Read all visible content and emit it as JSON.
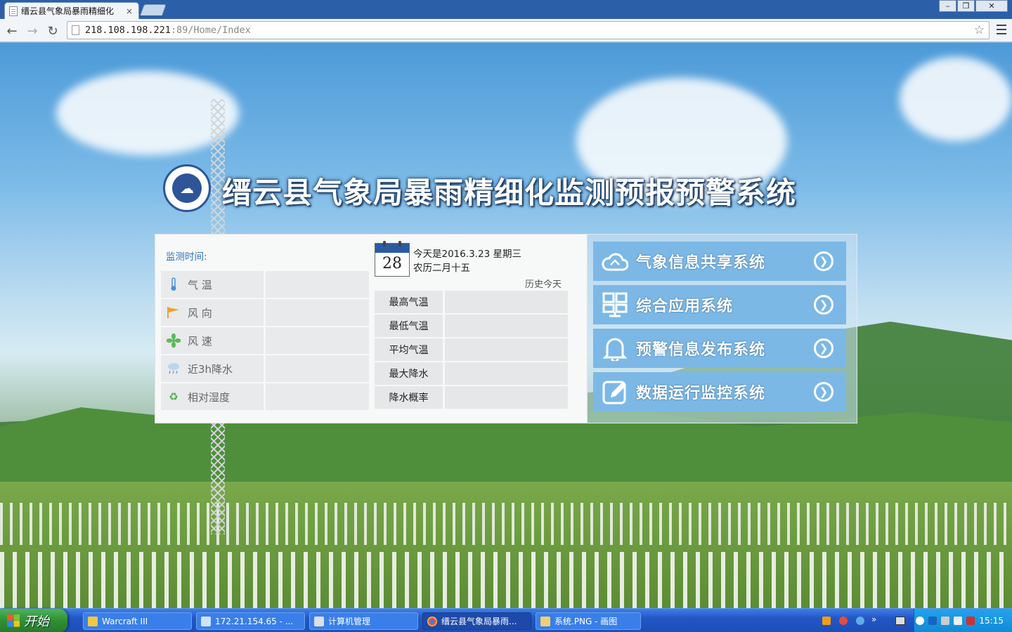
{
  "browser": {
    "tab_title": "缙云县气象局暴雨精细化",
    "tab_close": "×",
    "url_host": "218.108.198.221",
    "url_path": ":89/Home/Index",
    "win_min": "–",
    "win_restore": "❐",
    "win_close": "✕"
  },
  "header": {
    "title": "缙云县气象局暴雨精细化监测预报预警系统"
  },
  "monitor": {
    "time_label": "监测时间:",
    "rows": [
      {
        "label": "气 温",
        "icon": "thermometer-icon",
        "value": ""
      },
      {
        "label": "风 向",
        "icon": "wind-direction-icon",
        "value": ""
      },
      {
        "label": "风 速",
        "icon": "fan-icon",
        "value": ""
      },
      {
        "label": "近3h降水",
        "icon": "rain-cloud-icon",
        "value": ""
      },
      {
        "label": "相对湿度",
        "icon": "humidity-icon",
        "value": ""
      }
    ]
  },
  "calendar": {
    "day": "28",
    "today_line": "今天是2016.3.23 星期三",
    "lunar_line": "农历二月十五",
    "history_label": "历史今天",
    "rows": [
      {
        "label": "最高气温",
        "value": ""
      },
      {
        "label": "最低气温",
        "value": ""
      },
      {
        "label": "平均气温",
        "value": ""
      },
      {
        "label": "最大降水",
        "value": ""
      },
      {
        "label": "降水概率",
        "value": ""
      }
    ]
  },
  "systems": [
    {
      "label": "气象信息共享系统",
      "icon": "cloud-share-icon"
    },
    {
      "label": "综合应用系统",
      "icon": "grid-icon"
    },
    {
      "label": "预警信息发布系统",
      "icon": "bell-icon"
    },
    {
      "label": "数据运行监控系统",
      "icon": "edit-icon"
    }
  ],
  "taskbar": {
    "start_label": "开始",
    "items": [
      {
        "label": "Warcraft III"
      },
      {
        "label": "172.21.154.65 - ..."
      },
      {
        "label": "计算机管理"
      },
      {
        "label": "缙云县气象局暴雨..."
      },
      {
        "label": "系统.PNG - 画图"
      }
    ],
    "clock": "15:15"
  },
  "colors": {
    "button_blue": "#7cb8e6",
    "title_blue": "#2e74b8"
  }
}
